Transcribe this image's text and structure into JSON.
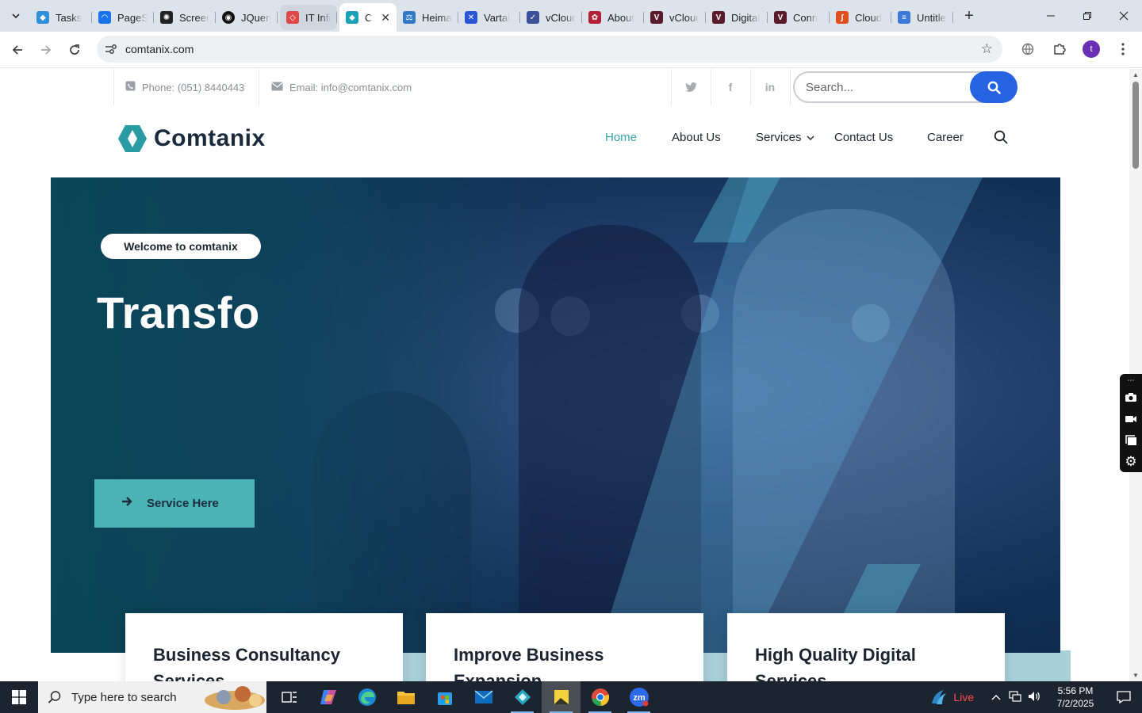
{
  "browser": {
    "tabs": [
      {
        "label": "Tasks",
        "fav_color": "#2f8fd8",
        "fav_glyph": "◆"
      },
      {
        "label": "PageSpeed",
        "fav_color": "#1a73e8",
        "fav_glyph": "◠"
      },
      {
        "label": "Screenshot",
        "fav_color": "#222222",
        "fav_glyph": "✺"
      },
      {
        "label": "JQuery",
        "fav_color": "#111111",
        "fav_glyph": "◉"
      },
      {
        "label": "IT Infra",
        "fav_color": "#e04848",
        "fav_glyph": "◇"
      },
      {
        "label": "C",
        "fav_color": "#1aa1b8",
        "fav_glyph": "◆"
      },
      {
        "label": "Heima",
        "fav_color": "#3178c6",
        "fav_glyph": "⚖"
      },
      {
        "label": "Vartal",
        "fav_color": "#2a56d6",
        "fav_glyph": "✕"
      },
      {
        "label": "vCloud",
        "fav_color": "#3b4f9a",
        "fav_glyph": "✓"
      },
      {
        "label": "About",
        "fav_color": "#b3203a",
        "fav_glyph": "✿"
      },
      {
        "label": "vCloud",
        "fav_color": "#5a1a2a",
        "fav_glyph": "V"
      },
      {
        "label": "Digital",
        "fav_color": "#5a1a2a",
        "fav_glyph": "V"
      },
      {
        "label": "Conn",
        "fav_color": "#5a1a2a",
        "fav_glyph": "V"
      },
      {
        "label": "Cloud",
        "fav_color": "#e0501f",
        "fav_glyph": "∫"
      },
      {
        "label": "Untitled",
        "fav_color": "#3c78d8",
        "fav_glyph": "≡"
      }
    ],
    "url": "comtanix.com"
  },
  "topbar": {
    "phone": "Phone: (051) 8440443",
    "email": "Email: info@comtanix.com",
    "search_placeholder": "Search..."
  },
  "nav": {
    "logo_text": "Comtanix",
    "items": [
      "Home",
      "About Us",
      "Services",
      "Contact Us",
      "Career"
    ]
  },
  "hero": {
    "welcome": "Welcome to comtanix",
    "headline": "Transfo",
    "button_label": "Service Here"
  },
  "cards": [
    {
      "title": "Business Consultancy Services"
    },
    {
      "title": "Improve Business Expansion"
    },
    {
      "title": "High Quality Digital Services"
    }
  ],
  "taskbar": {
    "search_placeholder": "Type here to search",
    "weather": "Live",
    "time": "5:56 PM",
    "date": "7/2/2025"
  },
  "colors": {
    "accent_teal": "#3aa3a8",
    "search_blue": "#2563e3",
    "button_teal": "#4ab3b5"
  }
}
